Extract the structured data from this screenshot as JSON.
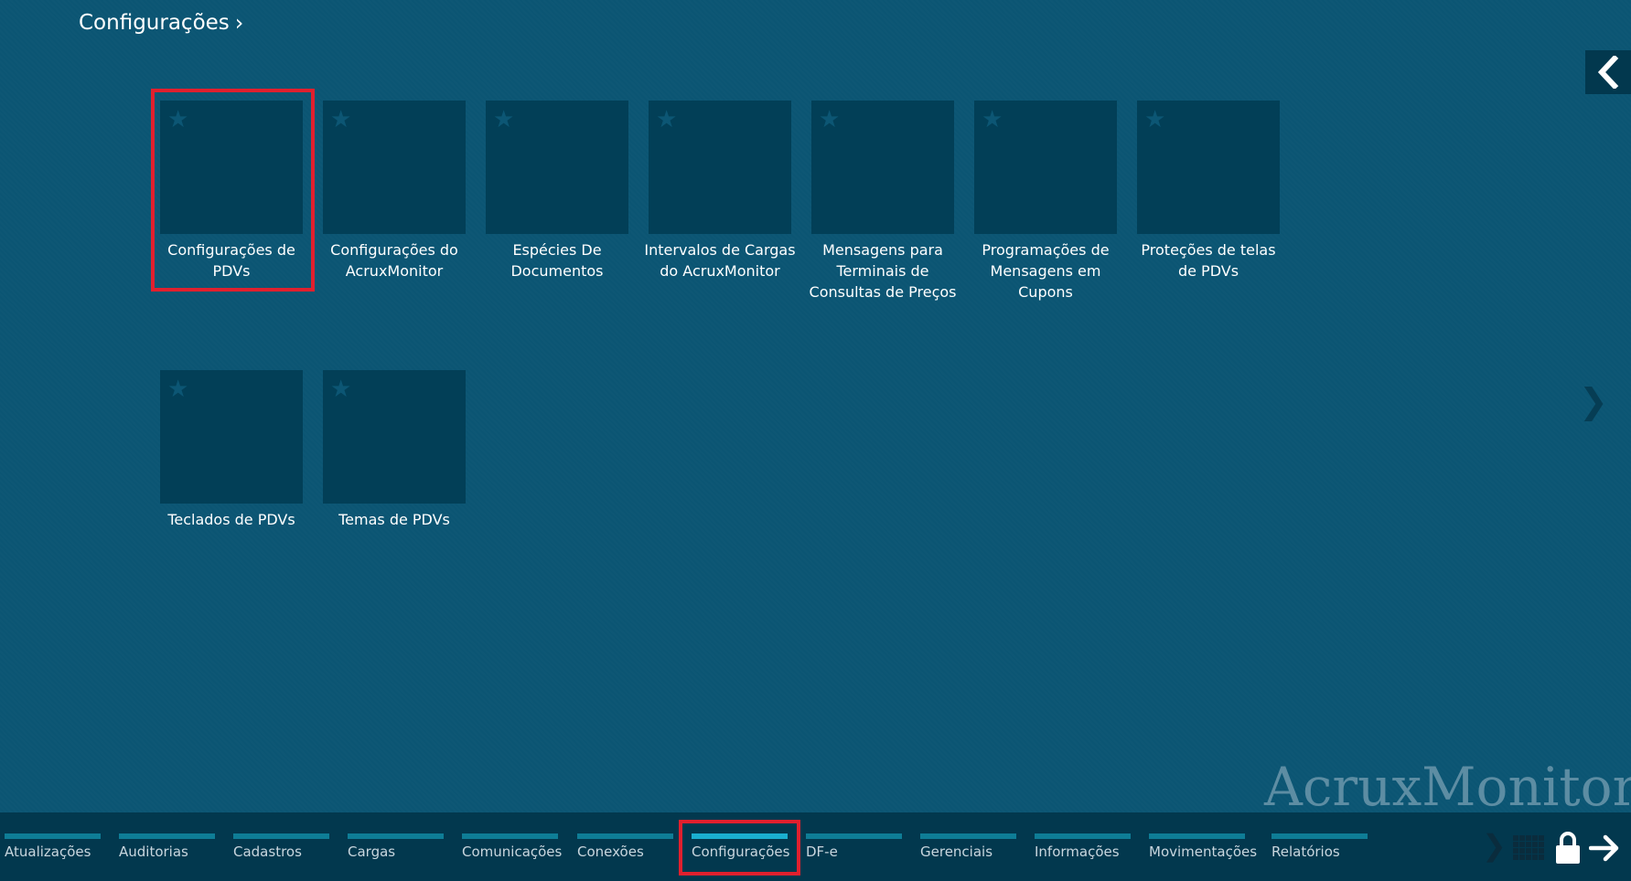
{
  "header": {
    "breadcrumb_label": "Configurações",
    "breadcrumb_chevron": "›"
  },
  "tiles": [
    {
      "label": "Configurações de PDVs",
      "icon": "star-icon",
      "highlighted": true
    },
    {
      "label": "Configurações do AcruxMonitor",
      "icon": "star-icon"
    },
    {
      "label": "Espécies De Documentos",
      "icon": "star-icon"
    },
    {
      "label": "Intervalos de Cargas do AcruxMonitor",
      "icon": "star-icon"
    },
    {
      "label": "Mensagens para Terminais de Consultas de Preços",
      "icon": "star-icon"
    },
    {
      "label": "Programações de Mensagens em Cupons",
      "icon": "star-icon"
    },
    {
      "label": "Proteções de telas de PDVs",
      "icon": "star-icon"
    },
    {
      "label": "Teclados de PDVs",
      "icon": "star-icon"
    },
    {
      "label": "Temas de PDVs",
      "icon": "star-icon"
    }
  ],
  "brand": {
    "text": "AcruxMonitor"
  },
  "taskbar": {
    "items": [
      {
        "label": "Atualizações"
      },
      {
        "label": "Auditorias"
      },
      {
        "label": "Cadastros"
      },
      {
        "label": "Cargas"
      },
      {
        "label": "Comunicações"
      },
      {
        "label": "Conexões"
      },
      {
        "label": "Configurações",
        "active": true
      },
      {
        "label": "DF-e"
      },
      {
        "label": "Gerenciais"
      },
      {
        "label": "Informações"
      },
      {
        "label": "Movimentações"
      },
      {
        "label": "Relatórios"
      }
    ],
    "icons": [
      "chevron-right-icon",
      "grid-icon",
      "lock-icon",
      "arrow-right-icon"
    ]
  },
  "colors": {
    "background": "#0b5573",
    "tile": "#023f57",
    "taskbar": "#02384e",
    "nav_bar": "#0e7d96",
    "nav_bar_active": "#1aaecf",
    "highlight": "#e0202e"
  }
}
